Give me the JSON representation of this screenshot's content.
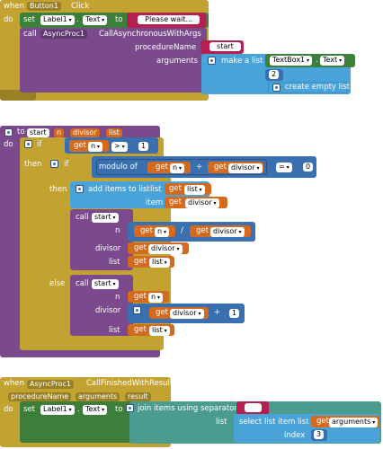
{
  "block1": {
    "when": "when",
    "event_component": "Button1",
    "event_name": "Click",
    "do": "do",
    "set": "set",
    "set_component": "Label1",
    "set_property": "Text",
    "to": "to",
    "text_value": "Please wait...",
    "call": "call",
    "call_component": "AsyncProc1",
    "call_method": "CallAsynchronousWithArgs",
    "procedure_name_label": "procedureName",
    "procedure_name_value": "start",
    "arguments_label": "arguments",
    "make_a_list": "make a list",
    "list_component": "TextBox1",
    "list_property": "Text",
    "list_number": "2",
    "create_empty_list": "create empty list"
  },
  "block2": {
    "to": "to",
    "proc_name": "start",
    "param_n": "n",
    "param_divisor": "divisor",
    "param_list": "list",
    "do": "do",
    "if": "if",
    "get": "get",
    "n": "n",
    "gt_op": ">",
    "one": "1",
    "then": "then",
    "modulo_of": "modulo of",
    "div_op": "÷",
    "divisor": "divisor",
    "eq_op": "=",
    "zero": "0",
    "add_items_to_list": "add items to list",
    "list_label": "list",
    "item_label": "item",
    "list": "list",
    "call": "call",
    "start": "start",
    "n_label": "n",
    "slash_op": "/",
    "divisor_label": "divisor",
    "else": "else",
    "plus_op": "+",
    "one_b": "1"
  },
  "block3": {
    "when": "when",
    "event_component": "AsyncProc1",
    "event_name": "CallFinishedWithResult",
    "param_procedure_name": "procedureName",
    "param_arguments": "arguments",
    "param_result": "result",
    "do": "do",
    "set": "set",
    "set_component": "Label1",
    "set_property": "Text",
    "to": "to",
    "join_items": "join items using separator",
    "separator_value": " ",
    "list_label": "list",
    "select_list_item": "select list item  list",
    "get": "get",
    "arguments": "arguments",
    "index_label": "index",
    "index_value": "3"
  }
}
